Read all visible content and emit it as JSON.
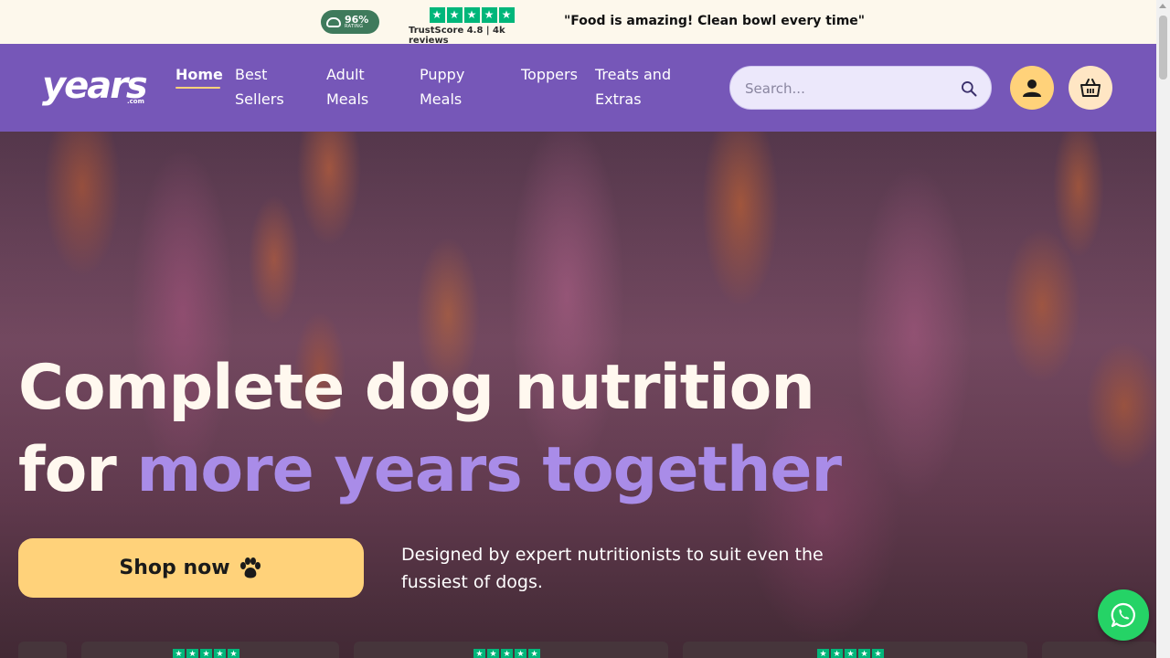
{
  "topbar": {
    "rating_percent": "96%",
    "rating_label": "RATING",
    "trustscore_text": "TrustScore 4.8 | 4k reviews",
    "star_count": 5,
    "quote": "\"Food is amazing! Clean bowl every time\""
  },
  "header": {
    "logo_text": "years",
    "logo_suffix": ".com",
    "nav": [
      {
        "label": "Home",
        "active": true
      },
      {
        "label": "Best Sellers"
      },
      {
        "label": "Adult Meals"
      },
      {
        "label": "Puppy Meals"
      },
      {
        "label": "Toppers"
      },
      {
        "label": "Treats and Extras"
      }
    ],
    "nav_lines": {
      "best_1": "Best",
      "best_2": "Sellers",
      "adult_1": "Adult",
      "adult_2": "Meals",
      "puppy_1": "Puppy",
      "puppy_2": "Meals",
      "treats_1": "Treats and",
      "treats_2": "Extras"
    },
    "search_placeholder": "Search...",
    "icons": {
      "search": "search-icon",
      "account": "user-icon",
      "cart": "basket-icon"
    }
  },
  "hero": {
    "headline_line1": "Complete dog nutrition",
    "headline_for": "for ",
    "headline_accent": "more years together",
    "cta_label": "Shop now",
    "description": "Designed by expert nutritionists to suit even the fussiest of dogs."
  },
  "colors": {
    "header_purple": "#7657b8",
    "accent_lavender": "#a98ce8",
    "cta_yellow": "#ffd27a",
    "trustpilot_green": "#00b67a",
    "whatsapp_green": "#25d366"
  }
}
